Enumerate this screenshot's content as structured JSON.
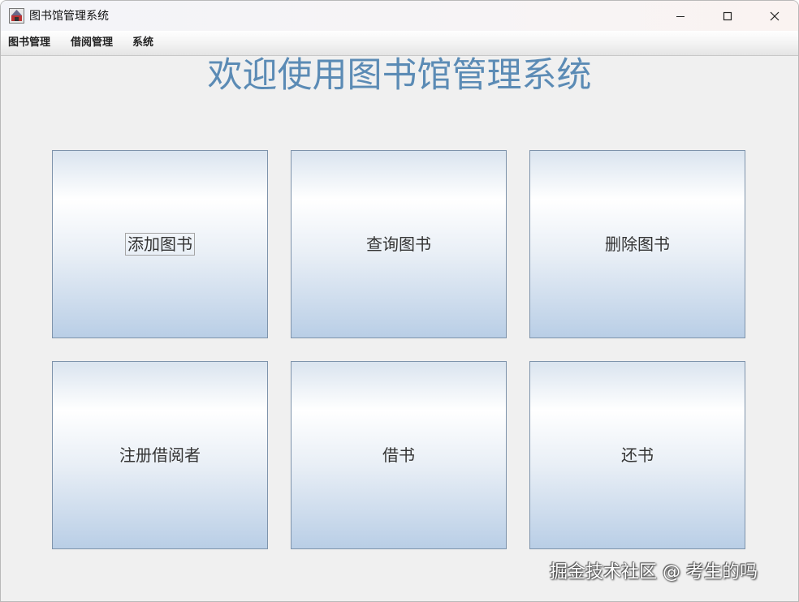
{
  "window": {
    "title": "图书馆管理系统",
    "controls": {
      "minimize_icon": "minimize-icon",
      "maximize_icon": "maximize-icon",
      "close_icon": "close-icon"
    }
  },
  "menubar": {
    "items": [
      "图书管理",
      "借阅管理",
      "系统"
    ]
  },
  "main": {
    "heading": "欢迎使用图书馆管理系统",
    "heading_color": "#5b8bb5",
    "tiles": [
      {
        "label": "添加图书"
      },
      {
        "label": "查询图书"
      },
      {
        "label": "删除图书"
      },
      {
        "label": "注册借阅者"
      },
      {
        "label": "借书"
      },
      {
        "label": "还书"
      }
    ]
  },
  "watermark": "掘金技术社区 @ 考生的吗"
}
